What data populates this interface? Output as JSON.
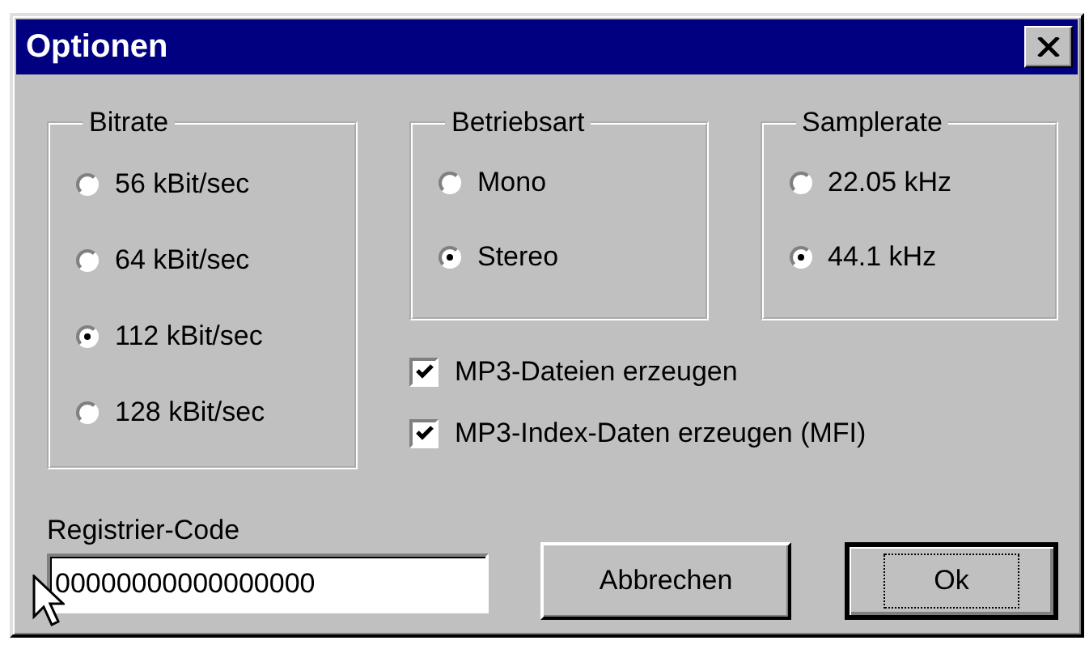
{
  "window": {
    "title": "Optionen"
  },
  "groups": [
    {
      "title": "Bitrate",
      "options": [
        {
          "label": "56 kBit/sec",
          "selected": false
        },
        {
          "label": "64 kBit/sec",
          "selected": false
        },
        {
          "label": "112 kBit/sec",
          "selected": true
        },
        {
          "label": "128 kBit/sec",
          "selected": false
        }
      ]
    },
    {
      "title": "Betriebsart",
      "options": [
        {
          "label": "Mono",
          "selected": false
        },
        {
          "label": "Stereo",
          "selected": true
        }
      ]
    },
    {
      "title": "Samplerate",
      "options": [
        {
          "label": "22.05 kHz",
          "selected": false
        },
        {
          "label": "44.1 kHz",
          "selected": true
        }
      ]
    }
  ],
  "checkboxes": [
    {
      "label": "MP3-Dateien erzeugen",
      "checked": true
    },
    {
      "label": "MP3-Index-Daten erzeugen (MFI)",
      "checked": true
    }
  ],
  "registration": {
    "label": "Registrier-Code",
    "value": "00000000000000000"
  },
  "buttons": [
    {
      "label": "Abbrechen",
      "default": false
    },
    {
      "label": "Ok",
      "default": true
    }
  ]
}
